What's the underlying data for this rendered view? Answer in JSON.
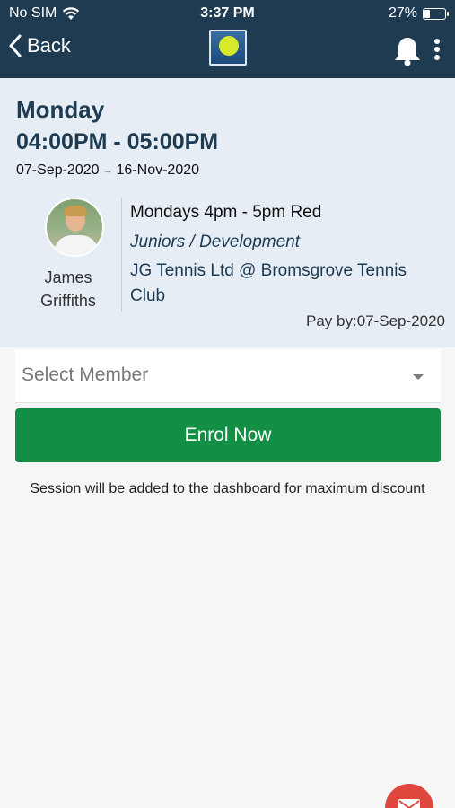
{
  "status_bar": {
    "carrier": "No SIM",
    "time": "3:37 PM",
    "battery": "27%"
  },
  "nav": {
    "back_label": "Back"
  },
  "session": {
    "day": "Monday",
    "time_range": "04:00PM - 05:00PM",
    "start_date": "07-Sep-2020",
    "end_date": "16-Nov-2020",
    "coach_first": "James",
    "coach_last": "Griffiths",
    "class_name": "Mondays 4pm - 5pm Red",
    "category": "Juniors / Development",
    "venue": "JG Tennis Ltd @ Bromsgrove Tennis Club",
    "pay_by": "Pay by:07-Sep-2020"
  },
  "form": {
    "select_placeholder": "Select Member",
    "enrol_label": "Enrol Now",
    "note": "Session will be added to the dashboard for maximum discount"
  },
  "colors": {
    "header": "#1e3b52",
    "panel": "#e6edf5",
    "enrol": "#138f45",
    "fab": "#e0483d"
  }
}
